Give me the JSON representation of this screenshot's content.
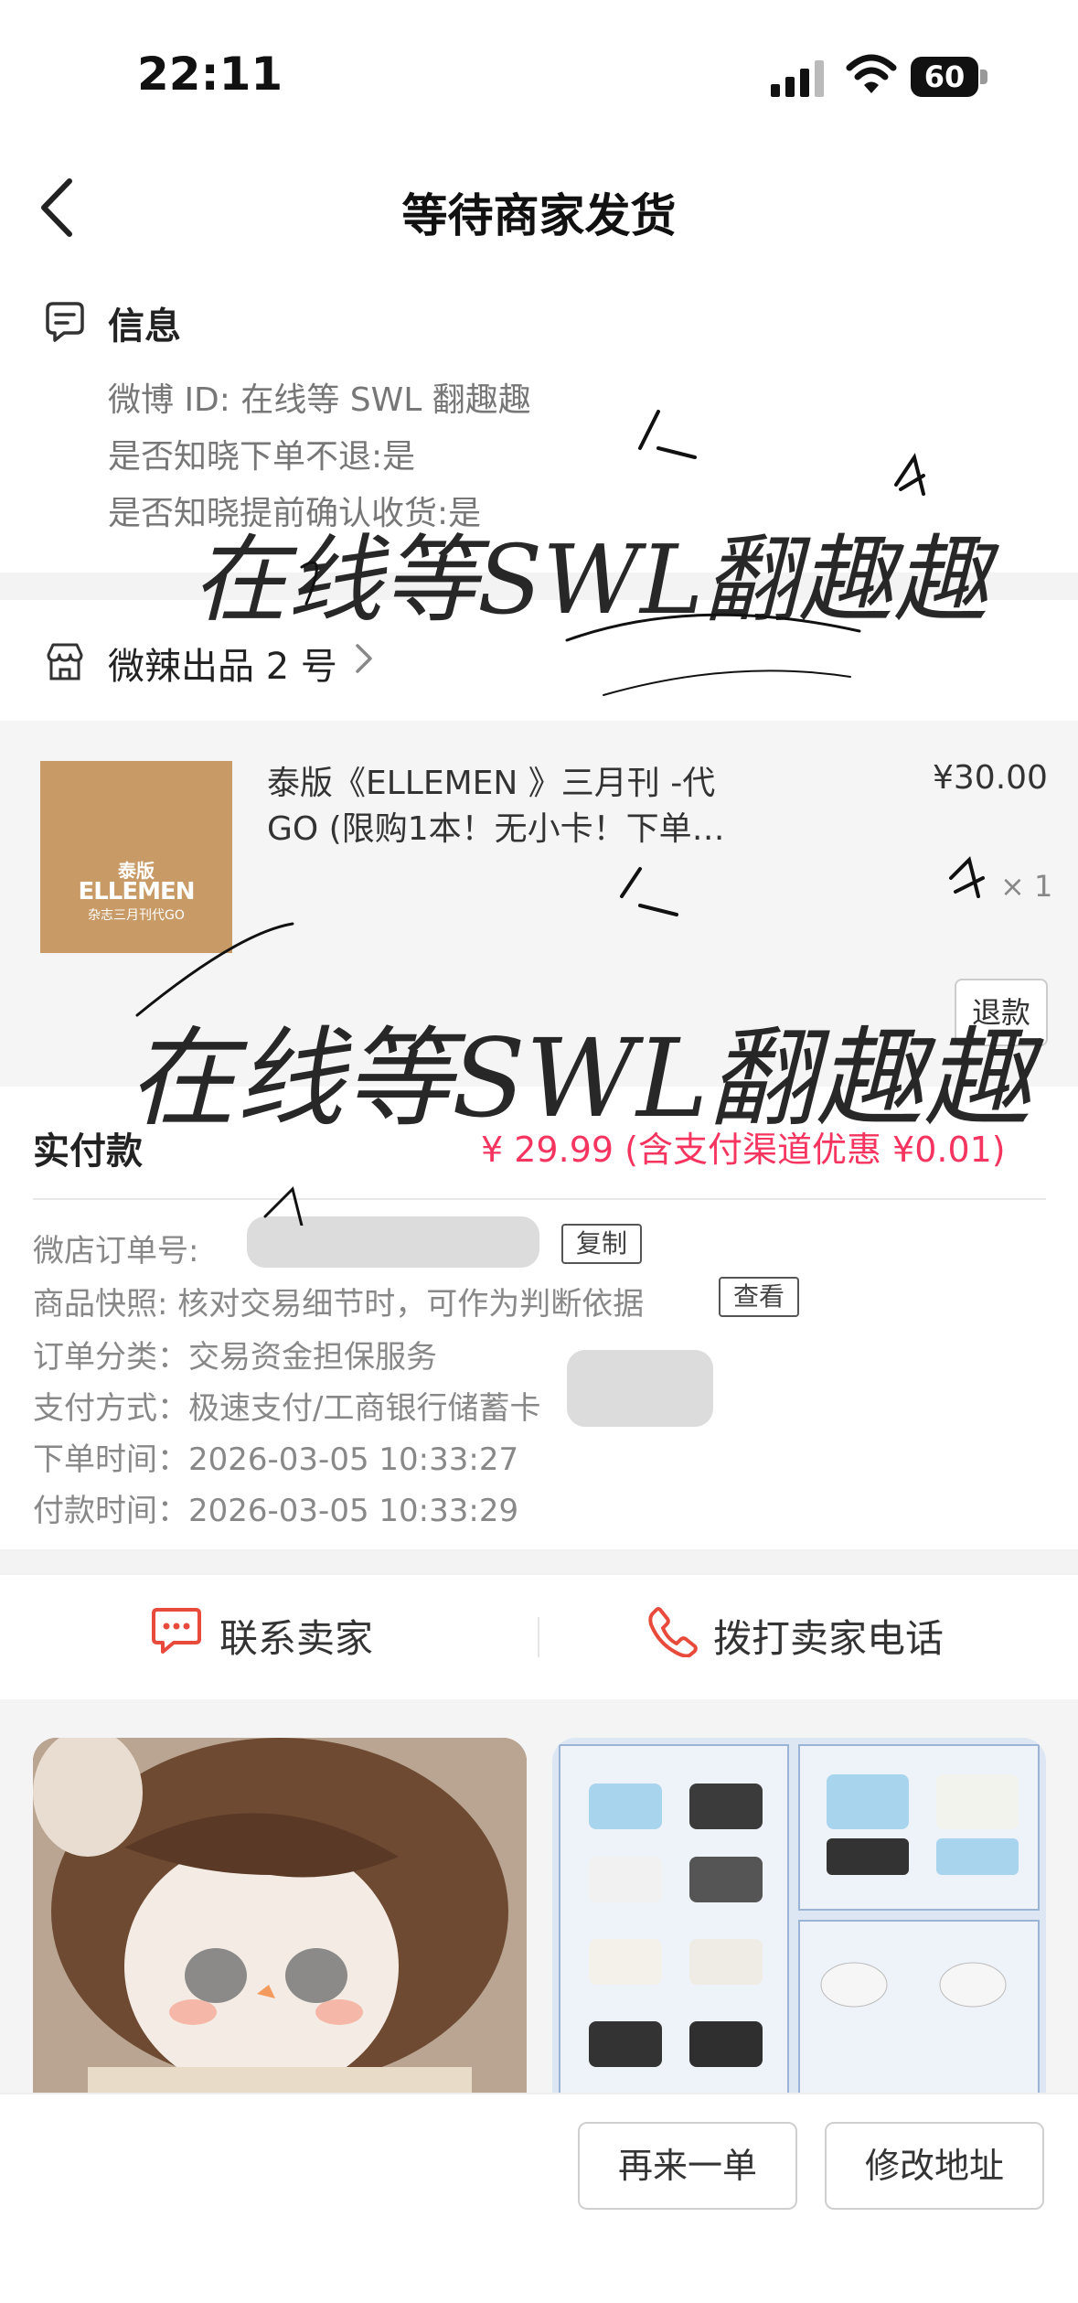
{
  "status_bar": {
    "time": "22:11",
    "battery": "60"
  },
  "nav": {
    "title": "等待商家发货"
  },
  "info": {
    "title": "信息",
    "lines": [
      "微博 ID: 在线等 SWL 翻趣趣",
      "是否知晓下单不退:是",
      "是否知晓提前确认收货:是"
    ]
  },
  "shop": {
    "name": "微辣出品 2 号"
  },
  "product": {
    "image_text": {
      "line1": "泰版",
      "line2": "ELLEMEN",
      "line3": "杂志三月刊代GO"
    },
    "title_line1": "泰版《ELLEMEN 》三月刊 -代",
    "title_line2": "GO (限购1本！无小卡！下单…",
    "price": "¥30.00",
    "quantity": "× 1",
    "refund_button": "退款"
  },
  "payment": {
    "paid_label": "实付款",
    "paid_value": "¥ 29.99 (含支付渠道优惠 ¥0.01)"
  },
  "order_details": {
    "order_no_label": "微店订单号:",
    "copy_button": "复制",
    "snapshot_text": "商品快照: 核对交易细节时，可作为判断依据",
    "view_button": "查看",
    "category": "订单分类：交易资金担保服务",
    "pay_method": "支付方式：极速支付/工商银行储蓄卡",
    "order_time": "下单时间：2026-03-05 10:33:27",
    "pay_time": "付款时间：2026-03-05 10:33:29"
  },
  "contact": {
    "contact_seller": "联系卖家",
    "call_seller": "拨打卖家电话"
  },
  "bottom_actions": {
    "reorder": "再来一单",
    "change_address": "修改地址"
  },
  "watermark": {
    "text": "在线等SWL翻趣趣"
  },
  "colors": {
    "price_red": "#f5355f",
    "icon_red": "#e84a3c"
  }
}
